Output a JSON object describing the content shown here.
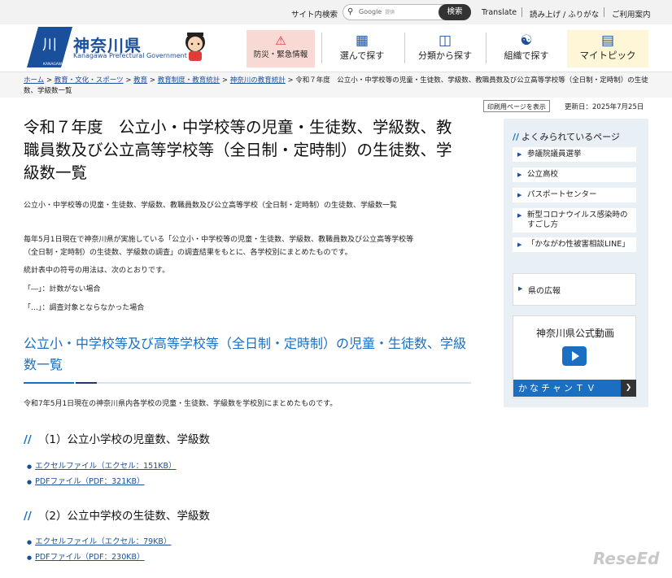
{
  "topbar": {
    "site_search": "サイト内検索",
    "google_label": "Google",
    "google_sub": "提供",
    "search_button": "検索",
    "translate": "Translate",
    "read_aloud": "読み上げ / ふりがな",
    "guide": "ご利用案内"
  },
  "header": {
    "logo_title": "神奈川県",
    "logo_sub": "Kanagawa Prefectural Government",
    "logo_mark_text": "KANAGAWA",
    "nav": {
      "emergency": "防災・緊急情報",
      "choose": "選んで探す",
      "category": "分類から探す",
      "org": "組織で探す",
      "mytopic": "マイトピック"
    }
  },
  "breadcrumb": {
    "items": [
      "ホーム",
      "教育・文化・スポーツ",
      "教育",
      "教育制度・教育統計",
      "神奈川の教育統計"
    ],
    "current": "令和７年度　公立小・中学校等の児童・生徒数、学級数、教職員数及び公立高等学校等（全日制・定時制）の生徒数、学級数一覧",
    "sep": ">"
  },
  "print_button": "印刷用ページを表示",
  "updated": "更新日：2025年7月25日",
  "page_title": "令和７年度　公立小・中学校等の児童・生徒数、学級数、教職員数及び公立高等学校等（全日制・定時制）の生徒数、学級数一覧",
  "summary": "公立小・中学校等の児童・生徒数、学級数、教職員数及び公立高等学校（全日制・定時制）の生徒数、学級数一覧",
  "intro": {
    "p1": "毎年5月1日現在で神奈川県が実施している「公立小・中学校等の児童・生徒数、学級数、教職員数及び公立高等学校等",
    "p2": "（全日制・定時制）の生徒数、学級数の調査」の調査結果をもとに、各学校別にまとめたものです。",
    "p3": "統計表中の符号の用法は、次のとおりです。",
    "p4": "「―」：計数がない場合",
    "p5": "「…」：調査対象とならなかった場合"
  },
  "section": {
    "title": "公立小・中学校等及び高等学校等（全日制・定時制）の児童・生徒数、学級数一覧",
    "desc": "令和7年5月1日現在の神奈川県内各学校の児童・生徒数、学級数を学校別にまとめたものです。"
  },
  "subsections": [
    {
      "title": "（1）公立小学校の児童数、学級数",
      "links": [
        "エクセルファイル（エクセル：151KB）",
        "PDFファイル（PDF：321KB）"
      ]
    },
    {
      "title": "（2）公立中学校の生徒数、学級数",
      "links": [
        "エクセルファイル（エクセル：79KB）",
        "PDFファイル（PDF：230KB）"
      ]
    }
  ],
  "sidebar": {
    "heading": "よくみられているページ",
    "items": [
      "参議院議員選挙",
      "公立高校",
      "パスポートセンター",
      "新型コロナウイルス感染時のすごし方",
      "「かながわ性被害相談LINE」"
    ],
    "koho": "県の広報",
    "video_title": "神奈川県公式動画",
    "video_bar": "かなチャンＴＶ"
  },
  "watermark": "ReseEd",
  "colors": {
    "brand": "#1a4f9c",
    "accent": "#1a6fc2",
    "emergency_bg": "#f9d9d3",
    "mytopic_bg": "#fef6d7"
  }
}
